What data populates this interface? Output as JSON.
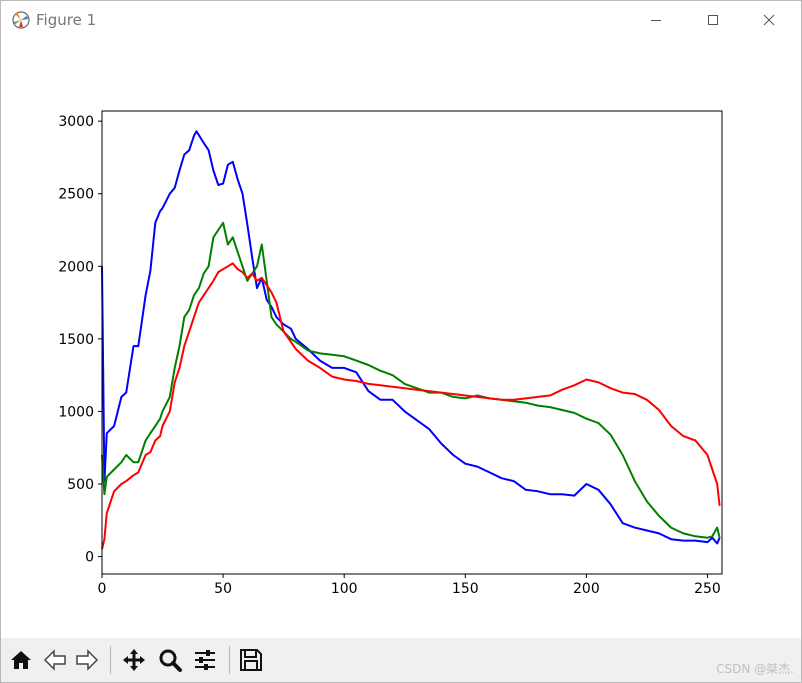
{
  "window": {
    "title": "Figure 1",
    "controls": {
      "minimize": "minimize",
      "maximize": "maximize",
      "close": "close"
    }
  },
  "toolbar": {
    "buttons": [
      "home-icon",
      "back-icon",
      "forward-icon",
      "pan-icon",
      "zoom-icon",
      "configure-subplots-icon",
      "save-icon"
    ]
  },
  "watermark": "CSDN @桀杰.",
  "chart_data": {
    "type": "line",
    "title": "",
    "xlabel": "",
    "ylabel": "",
    "xlim": [
      0,
      256
    ],
    "ylim": [
      -120,
      3070
    ],
    "xticks": [
      0,
      50,
      100,
      150,
      200,
      250
    ],
    "yticks": [
      0,
      500,
      1000,
      1500,
      2000,
      2500,
      3000
    ],
    "grid": false,
    "legend": "none",
    "series": [
      {
        "color": "#0000ff",
        "x": [
          0,
          1,
          2,
          5,
          8,
          10,
          13,
          15,
          18,
          20,
          22,
          24,
          25,
          28,
          30,
          32,
          34,
          36,
          38,
          39,
          42,
          44,
          46,
          48,
          50,
          52,
          54,
          56,
          58,
          60,
          62,
          64,
          66,
          68,
          70,
          72,
          75,
          78,
          80,
          85,
          90,
          95,
          100,
          105,
          110,
          115,
          120,
          125,
          130,
          135,
          140,
          145,
          150,
          155,
          160,
          165,
          170,
          175,
          180,
          185,
          190,
          195,
          200,
          205,
          210,
          215,
          220,
          225,
          230,
          235,
          240,
          245,
          250,
          252,
          254,
          255
        ],
        "values": [
          2000,
          520,
          850,
          900,
          1100,
          1130,
          1450,
          1450,
          1800,
          1970,
          2300,
          2380,
          2400,
          2500,
          2540,
          2660,
          2770,
          2800,
          2900,
          2930,
          2850,
          2800,
          2660,
          2560,
          2570,
          2700,
          2720,
          2600,
          2500,
          2290,
          2060,
          1850,
          1920,
          1770,
          1720,
          1650,
          1600,
          1570,
          1500,
          1430,
          1350,
          1300,
          1300,
          1270,
          1140,
          1080,
          1080,
          1000,
          940,
          880,
          780,
          700,
          640,
          620,
          580,
          540,
          520,
          460,
          450,
          430,
          430,
          420,
          500,
          460,
          360,
          230,
          200,
          180,
          160,
          120,
          110,
          110,
          100,
          130,
          90,
          130
        ]
      },
      {
        "color": "#008000",
        "x": [
          0,
          1,
          2,
          5,
          8,
          10,
          13,
          15,
          18,
          20,
          22,
          24,
          25,
          28,
          30,
          32,
          34,
          36,
          38,
          40,
          42,
          44,
          46,
          48,
          50,
          52,
          54,
          56,
          58,
          60,
          62,
          64,
          66,
          68,
          70,
          72,
          75,
          78,
          80,
          85,
          90,
          95,
          100,
          105,
          110,
          115,
          120,
          125,
          130,
          135,
          140,
          145,
          150,
          155,
          160,
          165,
          170,
          175,
          180,
          185,
          190,
          195,
          200,
          205,
          210,
          215,
          220,
          225,
          230,
          235,
          240,
          245,
          250,
          252,
          254,
          255
        ],
        "values": [
          700,
          430,
          550,
          600,
          650,
          700,
          650,
          650,
          800,
          850,
          900,
          950,
          1000,
          1100,
          1300,
          1450,
          1650,
          1700,
          1800,
          1850,
          1950,
          2000,
          2200,
          2250,
          2300,
          2150,
          2200,
          2100,
          2000,
          1900,
          1950,
          2000,
          2150,
          1900,
          1650,
          1600,
          1550,
          1500,
          1480,
          1420,
          1400,
          1390,
          1380,
          1350,
          1320,
          1280,
          1250,
          1190,
          1160,
          1130,
          1130,
          1100,
          1090,
          1110,
          1090,
          1080,
          1070,
          1060,
          1040,
          1030,
          1010,
          990,
          950,
          920,
          840,
          700,
          520,
          380,
          280,
          200,
          160,
          140,
          130,
          140,
          200,
          130
        ]
      },
      {
        "color": "#ff0000",
        "x": [
          0,
          1,
          2,
          5,
          8,
          10,
          13,
          15,
          18,
          20,
          22,
          24,
          25,
          28,
          30,
          32,
          34,
          36,
          38,
          40,
          42,
          44,
          46,
          48,
          50,
          52,
          54,
          56,
          58,
          60,
          62,
          64,
          66,
          68,
          70,
          72,
          75,
          78,
          80,
          85,
          90,
          95,
          100,
          105,
          110,
          115,
          120,
          125,
          130,
          135,
          140,
          145,
          150,
          155,
          160,
          165,
          170,
          175,
          180,
          185,
          190,
          195,
          200,
          205,
          210,
          215,
          220,
          225,
          230,
          235,
          240,
          245,
          250,
          252,
          254,
          255
        ],
        "values": [
          50,
          120,
          300,
          450,
          500,
          520,
          560,
          580,
          700,
          720,
          800,
          830,
          900,
          1000,
          1200,
          1300,
          1450,
          1550,
          1650,
          1750,
          1800,
          1850,
          1900,
          1960,
          1980,
          2000,
          2020,
          1980,
          1960,
          1920,
          1950,
          1900,
          1920,
          1870,
          1820,
          1750,
          1550,
          1480,
          1430,
          1350,
          1300,
          1240,
          1220,
          1210,
          1190,
          1180,
          1170,
          1160,
          1150,
          1140,
          1130,
          1120,
          1110,
          1100,
          1090,
          1080,
          1080,
          1090,
          1100,
          1110,
          1150,
          1180,
          1220,
          1200,
          1160,
          1130,
          1120,
          1080,
          1010,
          900,
          830,
          800,
          700,
          600,
          500,
          350
        ]
      }
    ]
  }
}
